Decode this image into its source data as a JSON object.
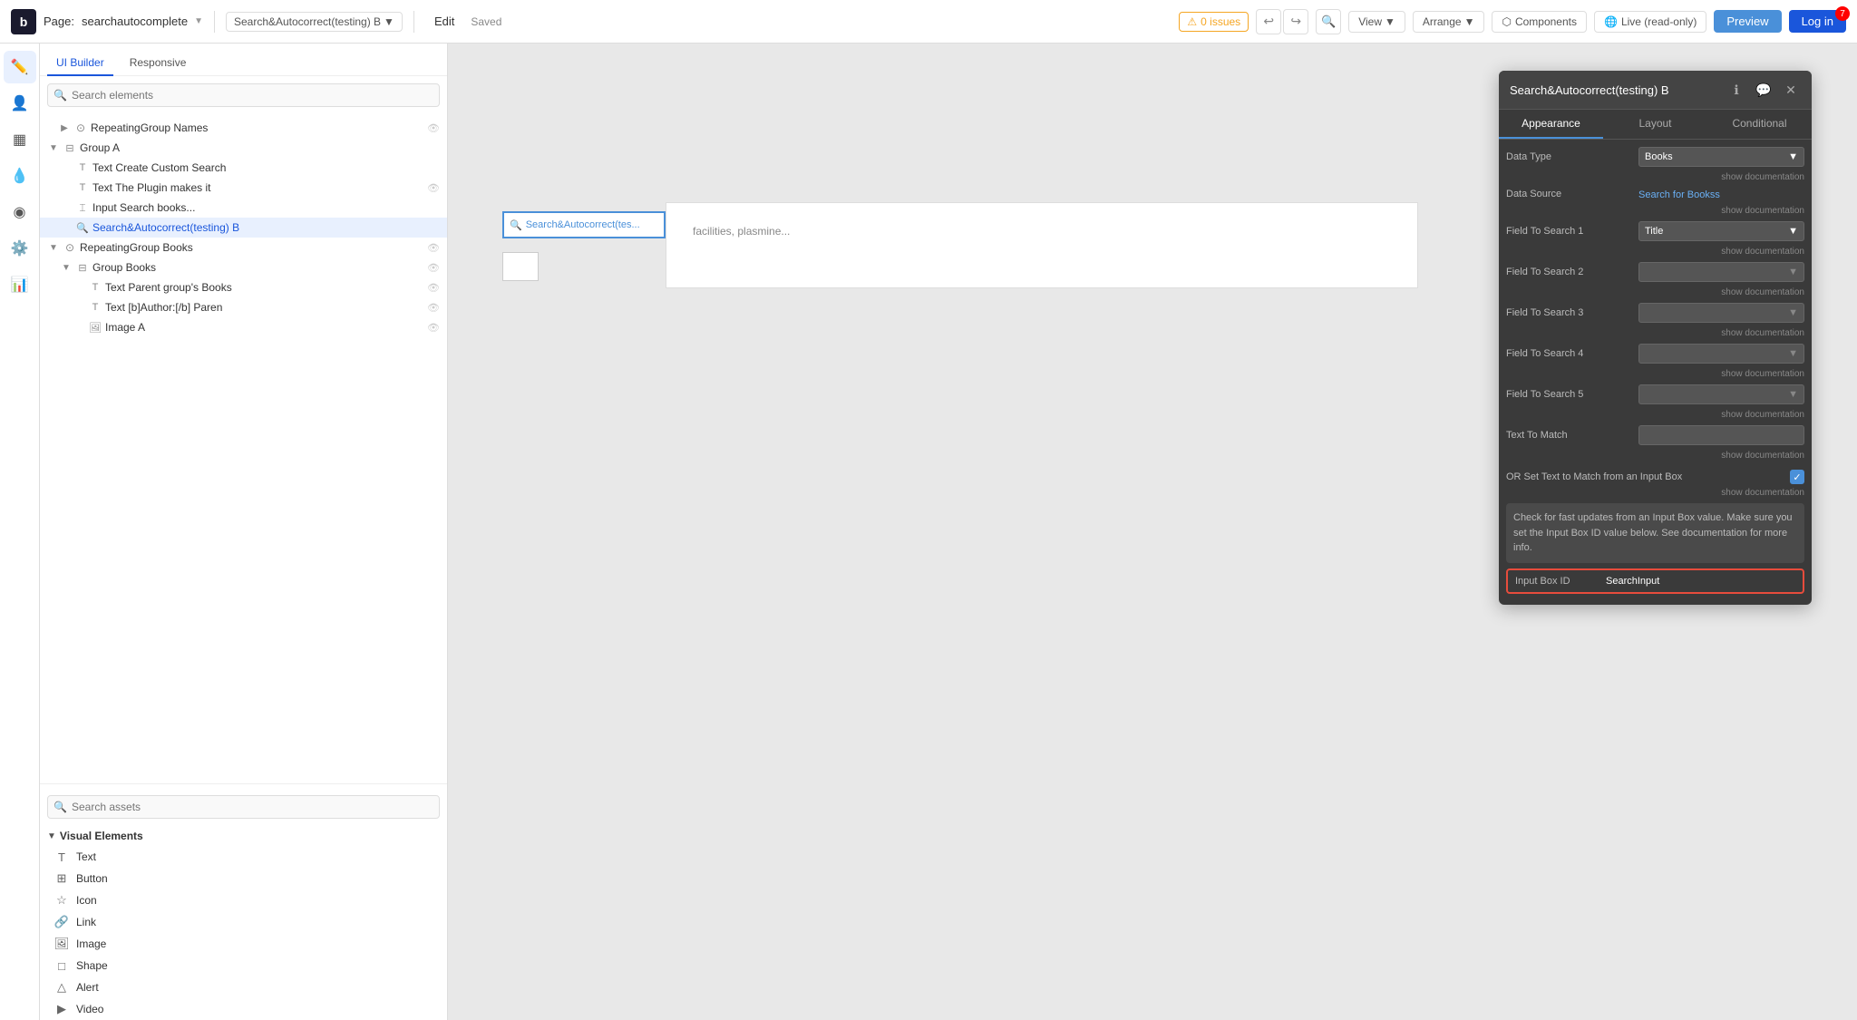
{
  "topbar": {
    "logo": "b",
    "page_label": "Page:",
    "page_name": "searchautocomplete",
    "element_name": "Search&Autocorrect(testing) B",
    "edit_label": "Edit",
    "saved_label": "Saved",
    "issues_count": "0 issues",
    "view_label": "View",
    "arrange_label": "Arrange",
    "components_label": "Components",
    "live_label": "Live (read-only)",
    "preview_label": "Preview",
    "login_label": "Log in",
    "notif_count": "7"
  },
  "left_panel": {
    "tabs": [
      "UI Builder",
      "Responsive"
    ],
    "search_placeholder": "Search elements",
    "assets_search_placeholder": "Search assets"
  },
  "tree": {
    "items": [
      {
        "id": "repeating-names",
        "label": "RepeatingGroup Names",
        "indent": 1,
        "has_toggle": true,
        "icon": "repeating",
        "has_eye": true
      },
      {
        "id": "group-a",
        "label": "Group A",
        "indent": 0,
        "has_toggle": true,
        "icon": "group",
        "has_eye": false
      },
      {
        "id": "text-create",
        "label": "Text Create Custom Search",
        "indent": 2,
        "has_toggle": false,
        "icon": "text",
        "has_eye": false
      },
      {
        "id": "text-plugin",
        "label": "Text The Plugin makes it",
        "indent": 2,
        "has_toggle": false,
        "icon": "text",
        "has_eye": true
      },
      {
        "id": "input-search",
        "label": "Input Search books...",
        "indent": 2,
        "has_toggle": false,
        "icon": "input",
        "has_eye": false
      },
      {
        "id": "search-autocorrect",
        "label": "Search&Autocorrect(testing) B",
        "indent": 2,
        "has_toggle": false,
        "icon": "search",
        "has_eye": false,
        "selected": true
      },
      {
        "id": "repeating-books",
        "label": "RepeatingGroup Books",
        "indent": 0,
        "has_toggle": true,
        "icon": "repeating",
        "has_eye": true
      },
      {
        "id": "group-books",
        "label": "Group Books",
        "indent": 1,
        "has_toggle": true,
        "icon": "group",
        "has_eye": true
      },
      {
        "id": "text-parent",
        "label": "Text Parent group's Books",
        "indent": 3,
        "has_toggle": false,
        "icon": "text",
        "has_eye": true
      },
      {
        "id": "text-author",
        "label": "Text [b]Author:[/b] Paren",
        "indent": 3,
        "has_toggle": false,
        "icon": "text",
        "has_eye": true
      },
      {
        "id": "image-a",
        "label": "Image A",
        "indent": 3,
        "has_toggle": false,
        "icon": "image",
        "has_eye": true
      }
    ]
  },
  "assets": {
    "search_placeholder": "Search assets",
    "sections": [
      {
        "label": "Visual Elements",
        "items": [
          {
            "label": "Text",
            "icon": "T"
          },
          {
            "label": "Button",
            "icon": "⊞"
          },
          {
            "label": "Icon",
            "icon": "☆"
          },
          {
            "label": "Link",
            "icon": "🔗"
          },
          {
            "label": "Image",
            "icon": "🖼"
          },
          {
            "label": "Shape",
            "icon": "□"
          },
          {
            "label": "Alert",
            "icon": "△"
          },
          {
            "label": "Video",
            "icon": "▶"
          }
        ]
      }
    ]
  },
  "props_panel": {
    "title": "Search&Autocorrect(testing) B",
    "tabs": [
      "Appearance",
      "Layout",
      "Conditional"
    ],
    "active_tab": "Appearance",
    "fields": {
      "data_type_label": "Data Type",
      "data_type_value": "Books",
      "data_source_label": "Data Source",
      "data_source_value": "Search for Bookss",
      "field1_label": "Field To Search 1",
      "field1_value": "Title",
      "field2_label": "Field To Search 2",
      "field2_value": "",
      "field3_label": "Field To Search 3",
      "field3_value": "",
      "field4_label": "Field To Search 4",
      "field4_value": "",
      "field5_label": "Field To Search 5",
      "field5_value": "",
      "text_to_match_label": "Text To Match",
      "text_to_match_value": "",
      "or_set_text_label": "OR Set Text to Match from an Input Box",
      "show_doc": "show documentation",
      "info_text": "Check for fast updates from an Input Box value. Make sure you set the Input Box ID value below. See documentation for more info.",
      "input_box_id_label": "Input Box ID",
      "input_box_id_value": "SearchInput"
    }
  },
  "canvas": {
    "breadcrumb_text": "facilities, plasmine...",
    "search_element_label": "Search&Autocorrect(tes..."
  }
}
